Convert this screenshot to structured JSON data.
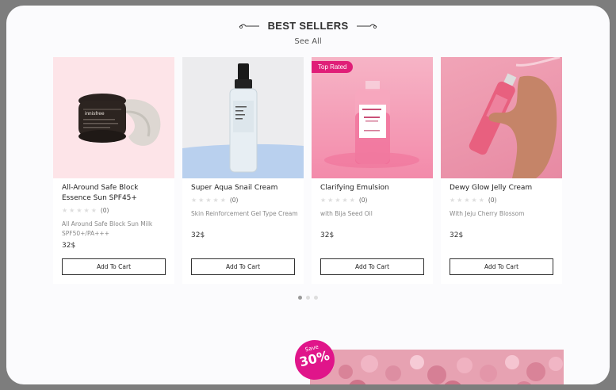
{
  "section": {
    "title": "BEST SELLERS",
    "see_all": "See All"
  },
  "products": [
    {
      "name": "All-Around Safe Block Essence Sun SPF45+",
      "rating_count": "(0)",
      "description": "All Around Safe Block Sun Milk SPF50+/PA+++",
      "price": "32$",
      "button": "Add To Cart",
      "badge": ""
    },
    {
      "name": "Super Aqua Snail Cream",
      "rating_count": "(0)",
      "description": "Skin Reinforcement Gel Type Cream",
      "price": "32$",
      "button": "Add To Cart",
      "badge": ""
    },
    {
      "name": "Clarifying Emulsion",
      "rating_count": "(0)",
      "description": "with Bija Seed Oil",
      "price": "32$",
      "button": "Add To Cart",
      "badge": "Top Rated"
    },
    {
      "name": "Dewy Glow Jelly Cream",
      "rating_count": "(0)",
      "description": "With Jeju Cherry Blossom",
      "price": "32$",
      "button": "Add To Cart",
      "badge": ""
    }
  ],
  "jar_label": "innisfree",
  "promo": {
    "save_label": "Save",
    "save_value": "30%"
  },
  "colors": {
    "accent": "#e01e78",
    "background": "#fbfbfd"
  }
}
